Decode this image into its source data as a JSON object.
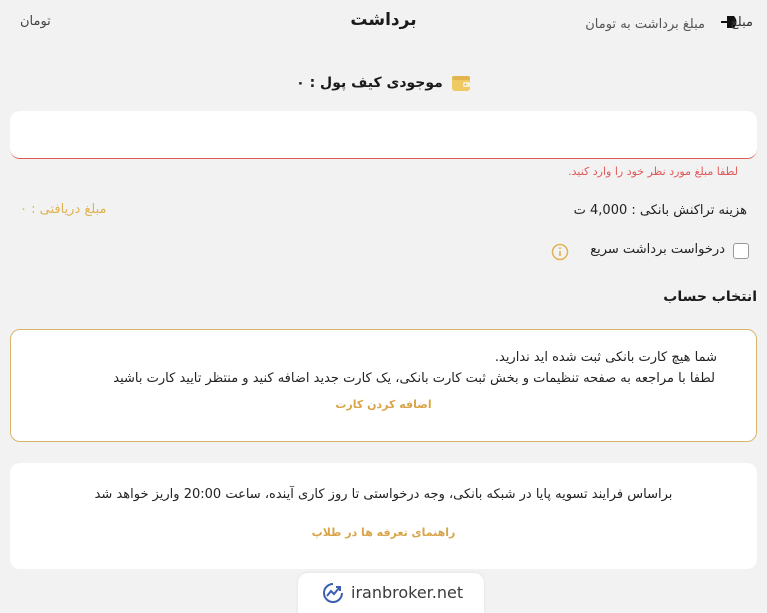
{
  "header": {
    "title": "برداشت"
  },
  "wallet": {
    "balance_label": "موجودی کیف پول : ۰"
  },
  "amount": {
    "label": "مبلغ",
    "placeholder": "مبلغ برداشت به تومان",
    "value": "",
    "unit": "تومان",
    "error": "لطفا مبلغ مورد نظر خود را وارد کنید."
  },
  "fee": {
    "text": "هزینه تراکنش بانکی : 4,000 ت",
    "received": "مبلغ دریافتی : ۰"
  },
  "fast_withdraw": {
    "label": "درخواست برداشت سریع",
    "checked": false
  },
  "account": {
    "title": "انتخاب حساب",
    "no_card_line1": "شما هیچ کارت بانکی ثبت شده اید ندارید.",
    "no_card_line2": "لطفا با مراجعه به صفحه تنظیمات و بخش ثبت کارت بانکی، یک کارت جدید اضافه کنید و منتظر تایید کارت باشید",
    "add_card_label": "اضافه کردن کارت"
  },
  "settlement": {
    "text": "براساس فرایند تسویه پایا در شبکه بانکی، وجه درخواستی تا روز کاری آینده، ساعت 20:00 واریز خواهد شد",
    "fees_link": "راهنمای تعرفه ها در طلاپ"
  },
  "watermark": {
    "text": "iranbroker.net"
  },
  "colors": {
    "background": "#f2f2f2",
    "accent_gold": "#d9a54a",
    "error_red": "#e05a5a",
    "card_border": "#d9b46a",
    "info_icon": "#e0b252"
  },
  "icons": {
    "back": "back-arrow-icon",
    "wallet": "wallet-icon",
    "info": "info-icon",
    "watermark": "chart-circle-icon"
  }
}
